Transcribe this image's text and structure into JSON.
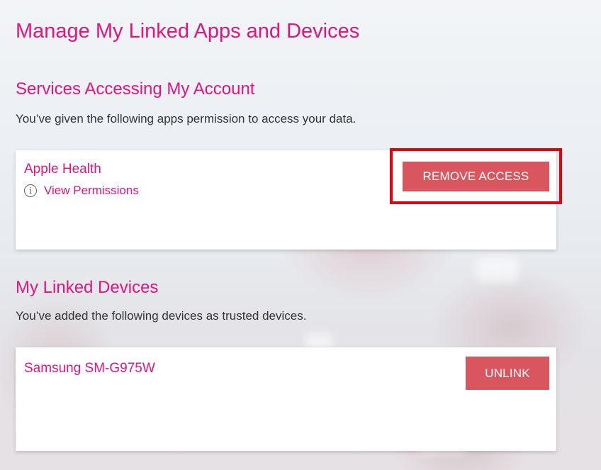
{
  "page": {
    "title": "Manage My Linked Apps and Devices"
  },
  "services": {
    "title": "Services Accessing My Account",
    "description": "You’ve given the following apps permission to access your data.",
    "items": [
      {
        "name": "Apple Health",
        "permissions_link": "View Permissions",
        "info_icon": "info-circle-icon",
        "button_label": "REMOVE ACCESS",
        "highlighted": true
      }
    ]
  },
  "devices": {
    "title": "My Linked Devices",
    "description": "You’ve added the following devices as trusted devices.",
    "items": [
      {
        "name": "Samsung SM-G975W",
        "button_label": "UNLINK"
      }
    ]
  },
  "colors": {
    "brand_magenta": "#e0157e",
    "button_red": "#d9565e",
    "highlight_red": "#e8000e"
  }
}
